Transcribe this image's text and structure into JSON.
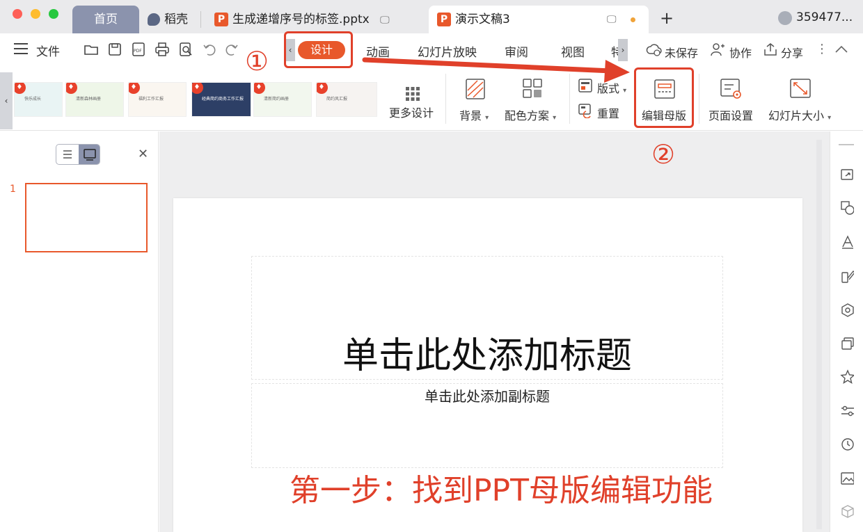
{
  "window": {
    "tabs": {
      "home": "首页",
      "daoke": "稻壳",
      "file_tab": "生成递增序号的标签.pptx",
      "active_tab": "演示文稿3",
      "add": "+"
    },
    "user_id": "359477..."
  },
  "menubar": {
    "menu": "文件",
    "tabs": [
      "设计",
      "动画",
      "幻灯片放映",
      "审阅",
      "视图",
      "特"
    ],
    "active_tab": "设计",
    "right": {
      "unsaved": "未保存",
      "collab": "协作",
      "share": "分享"
    }
  },
  "ribbon": {
    "more_design": "更多设计",
    "background": "背景",
    "color_scheme": "配色方案",
    "layout": "版式",
    "reset": "重置",
    "edit_master": "编辑母版",
    "page_setup": "页面设置",
    "slide_size": "幻灯片大小",
    "templates": [
      {
        "caption": "快乐成长",
        "color": "#e9f4f4"
      },
      {
        "caption": "清新森林画册",
        "color": "#eef6e8"
      },
      {
        "caption": "福利工作汇报",
        "color": "#faf6f0"
      },
      {
        "caption": "经典简约商务工作汇报",
        "color": "#2d3f66"
      },
      {
        "caption": "清新简约画册",
        "color": "#f2f7ee"
      },
      {
        "caption": "简约风汇报",
        "color": "#f6f3f1"
      }
    ]
  },
  "slides_panel": {
    "slide_number": "1"
  },
  "slide": {
    "title_placeholder": "单击此处添加标题",
    "subtitle_placeholder": "单击此处添加副标题"
  },
  "annotations": {
    "step1": "①",
    "step2": "②",
    "caption": "第一步：找到PPT母版编辑功能"
  },
  "colors": {
    "accent": "#e8582b",
    "annotation": "#e0402a",
    "home_tab": "#8b93ad"
  }
}
